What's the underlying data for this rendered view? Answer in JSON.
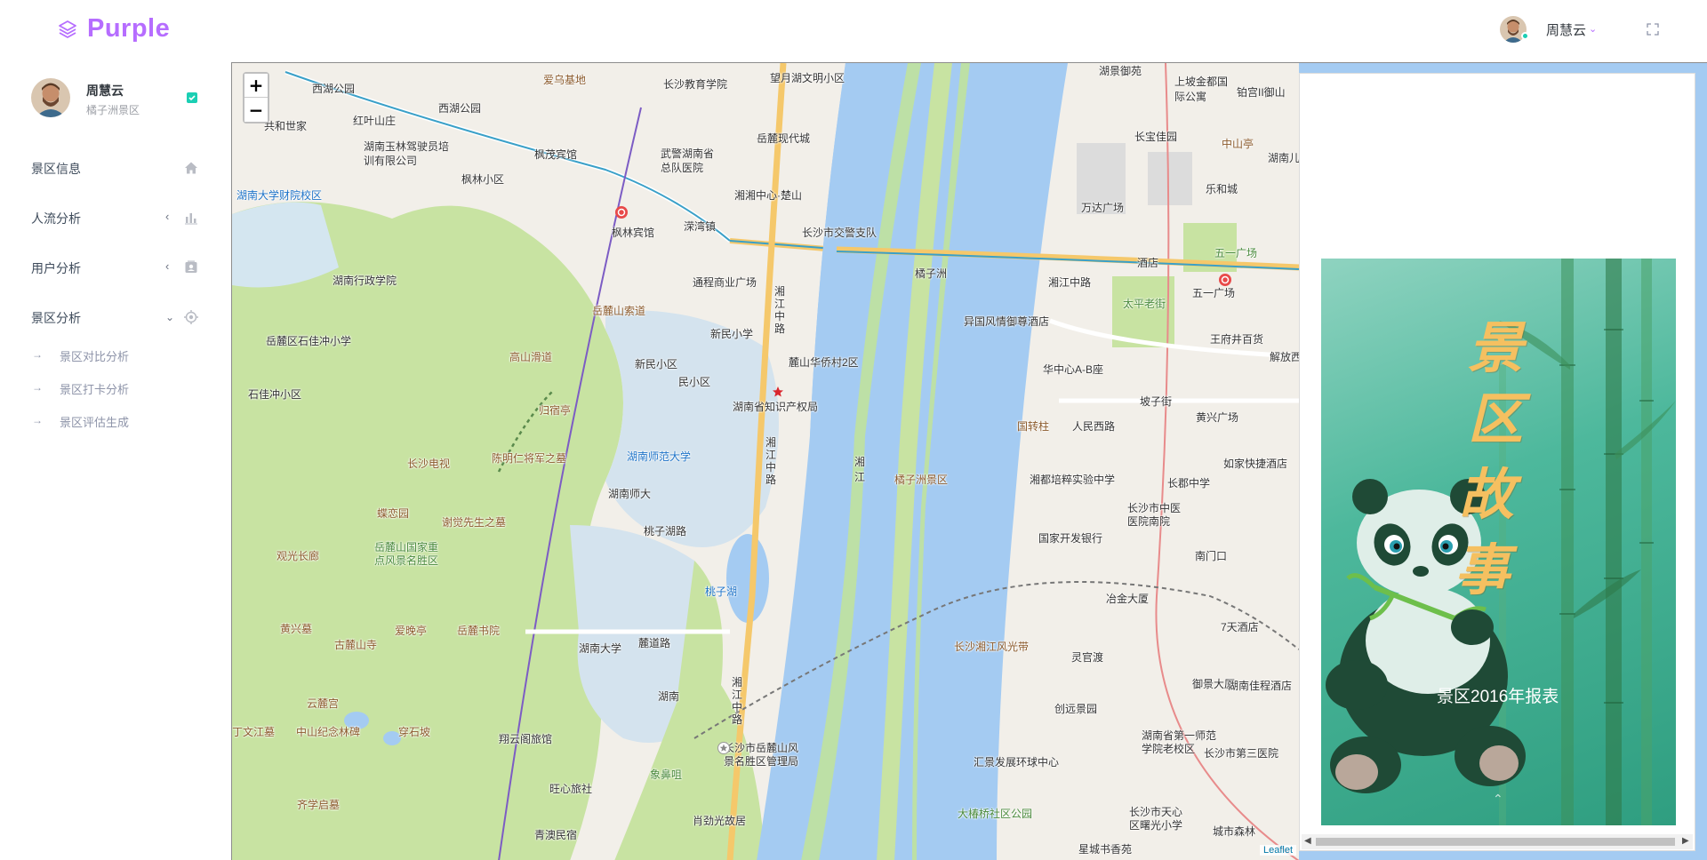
{
  "brand": {
    "name": "Purple"
  },
  "navbar": {
    "user_name": "周慧云"
  },
  "profile": {
    "name": "周慧云",
    "subtitle": "橘子洲景区"
  },
  "sidebar": {
    "items": [
      {
        "label": "景区信息",
        "icon": "home-icon"
      },
      {
        "label": "人流分析",
        "icon": "bar-chart-icon"
      },
      {
        "label": "用户分析",
        "icon": "contacts-icon"
      },
      {
        "label": "景区分析",
        "icon": "crosshairs-gps-icon"
      }
    ],
    "subitems": [
      {
        "label": "景区对比分析"
      },
      {
        "label": "景区打卡分析"
      },
      {
        "label": "景区评估生成"
      }
    ]
  },
  "map": {
    "attribution": "Leaflet",
    "zoom_in": "+",
    "zoom_out": "−",
    "labels": [
      "西湖公园",
      "爱乌基地",
      "长沙教育学院",
      "望月湖文明小区",
      "湖景御苑",
      "上坡金都国际公寓",
      "铂宫II御山",
      "红叶山庄",
      "西湖公园",
      "共和世家",
      "岳麓现代城",
      "湖南玉林驾驶员培训有限公司",
      "枫茂宾馆",
      "武警湖南省总队医院",
      "长宝佳园",
      "中山亭",
      "湖南儿童",
      "枫林小区",
      "湖南大学财院校区",
      "湘湘中心·楚山",
      "乐和城",
      "万达广场",
      "溁湾镇",
      "枫林宾馆",
      "长沙市交警支队",
      "五一广场",
      "橘子洲",
      "湘江中路",
      "酒店",
      "五一广场",
      "湖南行政学院",
      "通程商业广场",
      "太平老街",
      "岳麓山索道",
      "新民小学",
      "异国风情御尊酒店",
      "王府井百货",
      "解放西路",
      "岳麓区石佳冲小学",
      "高山滑道",
      "新民小区",
      "民小区",
      "麓山华侨村2区",
      "华中心A-B座",
      "石佳冲小区",
      "归宿亭",
      "湖南省知识产权局",
      "坡子街",
      "黄兴广场",
      "国转柱",
      "人民西路",
      "湖南师范大学",
      "长沙电视",
      "陈明仁将军之墓",
      "如家快捷酒店",
      "湘江",
      "橘子洲景区",
      "湘都培粹实验中学",
      "长郡中学",
      "湖南师大",
      "蝶恋园",
      "谢觉先生之墓",
      "长沙市中医医院南院",
      "桃子湖路",
      "观光长廊",
      "国家开发银行",
      "岳麓山国家重点风景名胜区",
      "南门口",
      "桃子湖",
      "冶金大厦",
      "黄兴墓",
      "爱晚亭",
      "岳麓书院",
      "7天酒店",
      "古麓山寺",
      "湖南大学",
      "麓道路",
      "长沙湘江风光带",
      "灵官渡",
      "云麓宫",
      "湖南",
      "御景大厦",
      "湖南佳程酒店",
      "创远景园",
      "丁文江墓",
      "中山纪念林碑",
      "穿石坡",
      "湖南省第一师范学院老校区",
      "翔云阁旅馆",
      "长沙市岳麓山风景名胜区管理局",
      "长沙市第三医院",
      "汇景发展环球中心",
      "旺心旅社",
      "象鼻咀",
      "齐学启墓",
      "大椿桥社区公园",
      "长沙市天心区曙光小学",
      "肖劲光故居",
      "城市森林",
      "青澳民宿",
      "星城书香苑",
      "湘江中路",
      "湘江中路",
      "湘江中路"
    ]
  },
  "report": {
    "title_chars": [
      "景",
      "区",
      "故",
      "事"
    ],
    "subtitle": "景区2016年报表",
    "colors": {
      "background": "#3aa98a",
      "title": "#f5c060"
    }
  },
  "colors": {
    "accent": "#b66dff",
    "status": "#1bcfb4"
  }
}
